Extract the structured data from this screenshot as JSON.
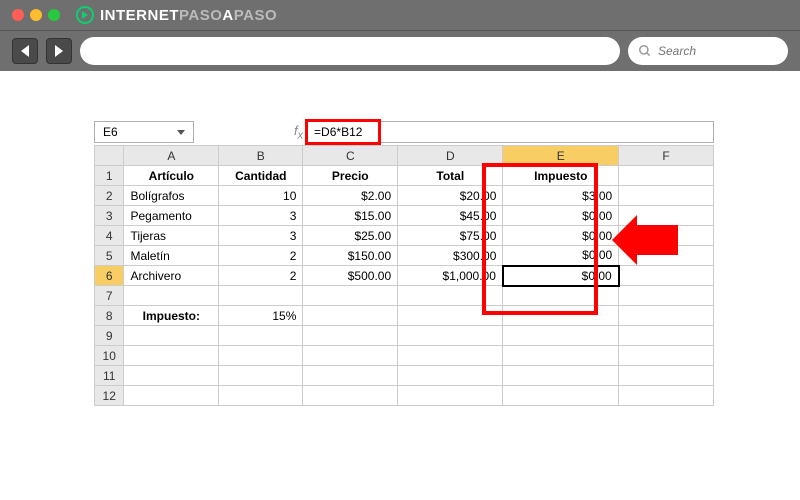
{
  "browser": {
    "logo_primary": "INTERNET",
    "logo_secondary": "PASO",
    "logo_tertiary": "A",
    "logo_quaternary": "PASO",
    "search_placeholder": "Search"
  },
  "excel": {
    "name_box": "E6",
    "formula": "=D6*B12",
    "columns": [
      "A",
      "B",
      "C",
      "D",
      "E",
      "F"
    ],
    "rows": [
      "1",
      "2",
      "3",
      "4",
      "5",
      "6",
      "7",
      "8",
      "9",
      "10",
      "11",
      "12"
    ],
    "headers": {
      "articulo": "Artículo",
      "cantidad": "Cantidad",
      "precio": "Precio",
      "total": "Total",
      "impuesto": "Impuesto"
    },
    "data": [
      {
        "art": "Bolígrafos",
        "cant": "10",
        "precio": "$2.00",
        "total": "$20.00",
        "imp": "$3.00"
      },
      {
        "art": "Pegamento",
        "cant": "3",
        "precio": "$15.00",
        "total": "$45.00",
        "imp": "$0.00"
      },
      {
        "art": "Tijeras",
        "cant": "3",
        "precio": "$25.00",
        "total": "$75.00",
        "imp": "$0.00"
      },
      {
        "art": "Maletín",
        "cant": "2",
        "precio": "$150.00",
        "total": "$300.00",
        "imp": "$0.00"
      },
      {
        "art": "Archivero",
        "cant": "2",
        "precio": "$500.00",
        "total": "$1,000.00",
        "imp": "$0.00"
      }
    ],
    "tax_label": "Impuesto:",
    "tax_value": "15%"
  }
}
